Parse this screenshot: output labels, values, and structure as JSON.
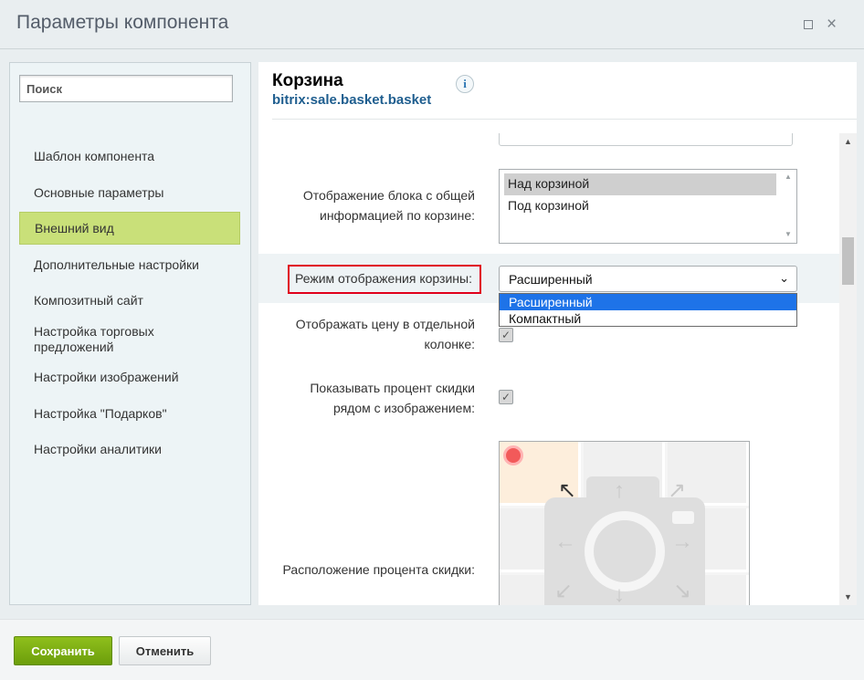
{
  "window": {
    "title": "Параметры компонента",
    "maximize_icon": "square",
    "close_icon": "×"
  },
  "sidebar": {
    "search_placeholder": "Поиск",
    "items": [
      {
        "label": "Шаблон компонента"
      },
      {
        "label": "Основные параметры"
      },
      {
        "label": "Внешний вид",
        "active": true
      },
      {
        "label": "Дополнительные настройки"
      },
      {
        "label": "Композитный сайт"
      },
      {
        "label": "Настройка торговых предложений"
      },
      {
        "label": "Настройки изображений"
      },
      {
        "label": "Настройка \"Подарков\""
      },
      {
        "label": "Настройки аналитики"
      }
    ]
  },
  "component": {
    "title": "Корзина",
    "code": "bitrix:sale.basket.basket",
    "info_icon": "i"
  },
  "params": {
    "total_block": {
      "label_line1": "Отображение блока с общей",
      "label_line2": "информацией по корзине:",
      "options": [
        "Над корзиной",
        "Под корзиной"
      ],
      "selected": "Над корзиной"
    },
    "display_mode": {
      "label": "Режим отображения корзины:",
      "value": "Расширенный",
      "options": [
        "Расширенный",
        "Компактный"
      ],
      "highlighted": "Расширенный"
    },
    "price_column": {
      "label_line1": "Отображать цену в отдельной",
      "label_line2": "колонке:",
      "checked": true
    },
    "discount_near_image": {
      "label_line1": "Показывать процент скидки",
      "label_line2": "рядом с изображением:",
      "checked": true
    },
    "discount_position": {
      "label": "Расположение процента скидки:",
      "selected_cell": "top-left"
    }
  },
  "footer": {
    "save_label": "Сохранить",
    "cancel_label": "Отменить"
  },
  "colors": {
    "active_nav": "#c9e079",
    "save_button": "#7aae13",
    "highlight_frame": "#e0001b",
    "dropdown_highlight": "#1e73e8"
  }
}
